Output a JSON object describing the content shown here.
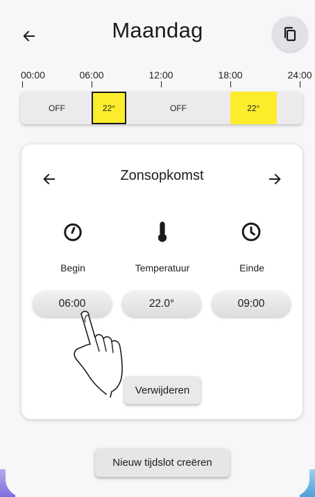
{
  "header": {
    "title": "Maandag",
    "back_icon": "arrow-left-icon",
    "copy_icon": "copy-icon"
  },
  "timeline": {
    "ticks": [
      "00:00",
      "06:00",
      "12:00",
      "18:00",
      "24:00"
    ],
    "segments": [
      {
        "label": "OFF",
        "start": "00:00",
        "end": "06:00",
        "color": "#eceaed",
        "selected": false
      },
      {
        "label": "22°",
        "start": "06:00",
        "end": "09:00",
        "color": "#fced2c",
        "selected": true
      },
      {
        "label": "OFF",
        "start": "09:00",
        "end": "18:00",
        "color": "#eceaed",
        "selected": false
      },
      {
        "label": "22°",
        "start": "18:00",
        "end": "22:00",
        "color": "#fced2c",
        "selected": false
      },
      {
        "label": "",
        "start": "22:00",
        "end": "24:00",
        "color": "#eceaed",
        "selected": false
      }
    ]
  },
  "card": {
    "title": "Zonsopkomst",
    "prev_icon": "arrow-left-icon",
    "next_icon": "arrow-right-icon",
    "columns": [
      {
        "label": "Begin",
        "value": "06:00",
        "icon": "timer-icon"
      },
      {
        "label": "Temperatuur",
        "value": "22.0°",
        "icon": "thermometer-icon"
      },
      {
        "label": "Einde",
        "value": "09:00",
        "icon": "clock-icon"
      }
    ],
    "delete_label": "Verwijderen"
  },
  "footer": {
    "new_label": "Nieuw tijdslot creëren"
  },
  "colors": {
    "accent_yellow": "#fced2c",
    "surface": "#f7f6f8",
    "card": "#ffffff"
  }
}
